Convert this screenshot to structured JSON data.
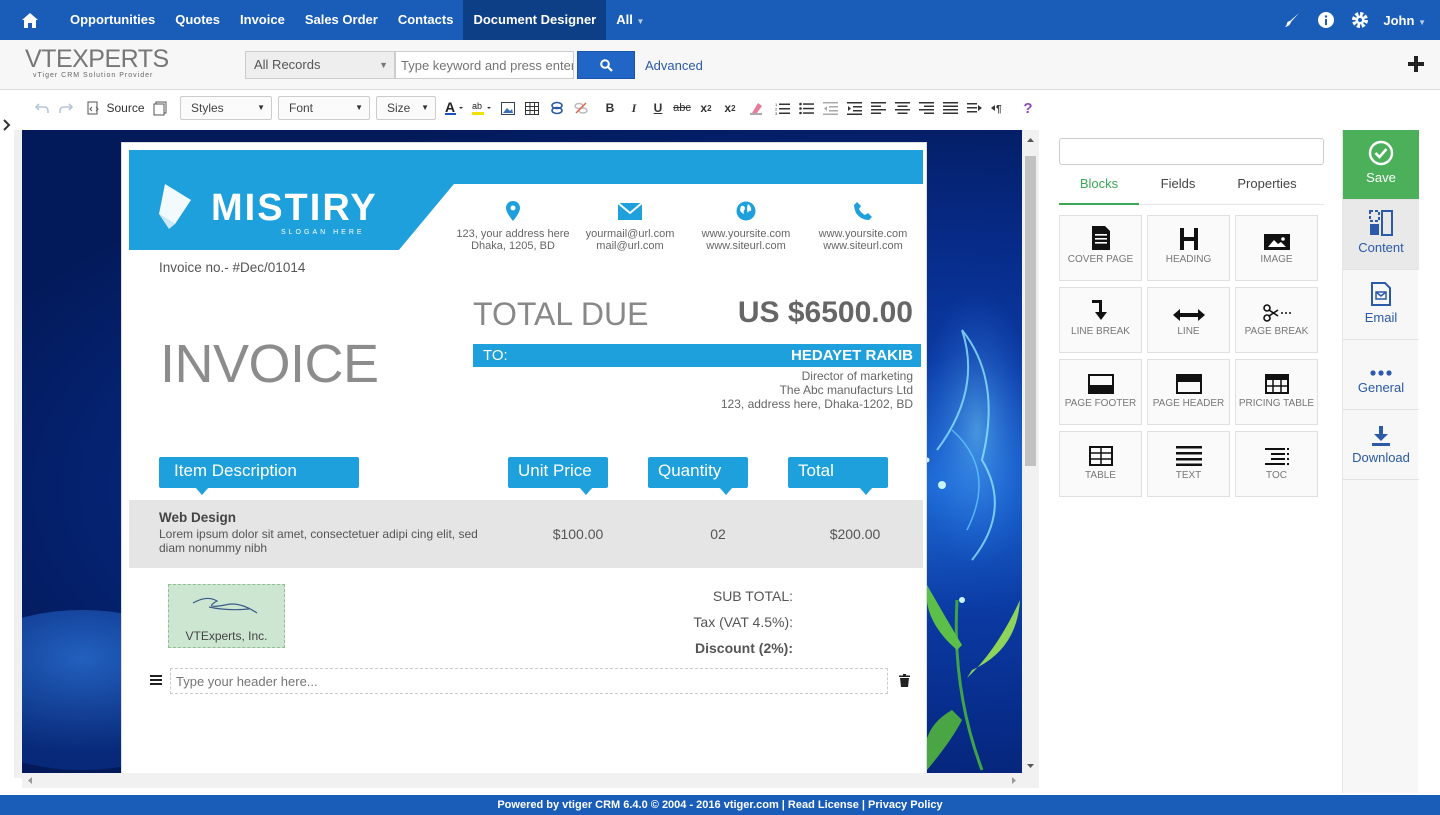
{
  "topnav": {
    "items": [
      "Opportunities",
      "Quotes",
      "Invoice",
      "Sales Order",
      "Contacts",
      "Document Designer"
    ],
    "all_label": "All",
    "user": "John"
  },
  "search": {
    "filter_value": "All Records",
    "placeholder": "Type keyword and press enter",
    "advanced_label": "Advanced"
  },
  "brand": {
    "logo_text": "VTEXPERTS",
    "logo_sub": "vTiger CRM Solution Provider"
  },
  "editor_toolbar": {
    "source_label": "Source",
    "styles_label": "Styles",
    "font_label": "Font",
    "size_label": "Size"
  },
  "invoice": {
    "company": "MISTIRY",
    "slogan": "SLOGAN HERE",
    "contacts": [
      {
        "icon": "map-pin-icon",
        "line1": "123, your address here",
        "line2": "Dhaka, 1205, BD"
      },
      {
        "icon": "envelope-icon",
        "line1": "yourmail@url.com",
        "line2": "mail@url.com"
      },
      {
        "icon": "globe-icon",
        "line1": "www.yoursite.com",
        "line2": "www.siteurl.com"
      },
      {
        "icon": "phone-icon",
        "line1": "www.yoursite.com",
        "line2": "www.siteurl.com"
      }
    ],
    "invoice_no": "Invoice no.- #Dec/01014",
    "title": "INVOICE",
    "total_due_label": "TOTAL DUE",
    "total_due_value": "US $6500.00",
    "to_label": "TO:",
    "to_name": "HEDAYET RAKIB",
    "to_lines": [
      "Director of marketing",
      "The Abc manufacturs Ltd",
      "123, address here, Dhaka-1202, BD"
    ],
    "columns": [
      "Item Description",
      "Unit Price",
      "Quantity",
      "Total"
    ],
    "item": {
      "name": "Web Design",
      "description": "Lorem ipsum dolor sit amet, consectetuer adipi cing elit, sed diam nonummy nibh",
      "unit_price": "$100.00",
      "quantity": "02",
      "total": "$200.00"
    },
    "signature_name": "VTExperts, Inc.",
    "summary": {
      "subtotal_label": "SUB TOTAL:",
      "tax_label": "Tax (VAT 4.5%):",
      "discount_label": "Discount (2%):"
    },
    "header_placeholder": "Type your header here..."
  },
  "panel": {
    "tabs": [
      "Blocks",
      "Fields",
      "Properties"
    ],
    "active_tab": "Blocks",
    "blocks": [
      "COVER PAGE",
      "HEADING",
      "IMAGE",
      "LINE BREAK",
      "LINE",
      "PAGE BREAK",
      "PAGE FOOTER",
      "PAGE HEADER",
      "PRICING TABLE",
      "TABLE",
      "TEXT",
      "TOC"
    ]
  },
  "rightbar": {
    "save": "Save",
    "content": "Content",
    "email": "Email",
    "general": "General",
    "download": "Download"
  },
  "footer": {
    "text": "Powered by vtiger CRM 6.4.0  © 2004 - 2016  vtiger.com | Read License | Privacy Policy"
  },
  "colors": {
    "nav_blue": "#1a5db8",
    "nav_active": "#0d3f86",
    "invoice_accent": "#1ea0dc",
    "save_green": "#4cb05b",
    "tab_green": "#3aa757"
  }
}
